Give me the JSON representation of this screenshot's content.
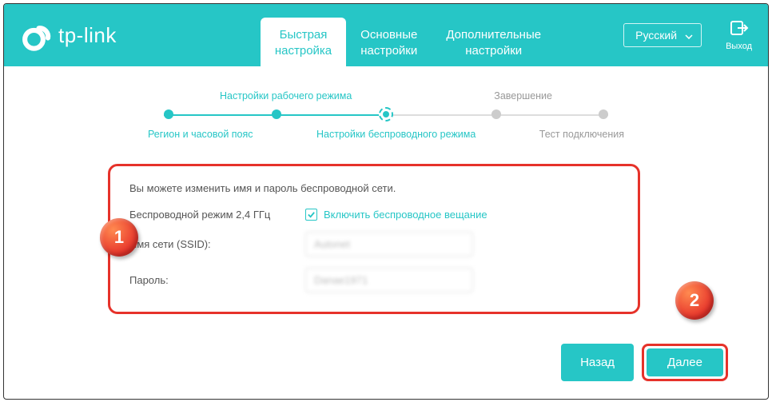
{
  "brand": "tp-link",
  "header": {
    "tabs": [
      {
        "line1": "Быстрая",
        "line2": "настройка"
      },
      {
        "line1": "Основные",
        "line2": "настройки"
      },
      {
        "line1": "Дополнительные",
        "line2": "настройки"
      }
    ],
    "language": "Русский",
    "exit": "Выход"
  },
  "stepper": {
    "top": {
      "mode": "Настройки рабочего режима",
      "finish": "Завершение"
    },
    "bottom": {
      "region": "Регион и часовой пояс",
      "wireless": "Настройки беспроводного режима",
      "test": "Тест подключения"
    }
  },
  "form": {
    "instruction": "Вы можете изменить имя и пароль беспроводной сети.",
    "band_label": "Беспроводной режим 2,4 ГГц",
    "enable_label": "Включить беспроводное вещание",
    "ssid_label": "Имя сети (SSID):",
    "ssid_value": "Autonet",
    "pass_label": "Пароль:",
    "pass_value": "Danae1971"
  },
  "buttons": {
    "back": "Назад",
    "next": "Далее"
  },
  "annotations": {
    "one": "1",
    "two": "2"
  },
  "colors": {
    "accent": "#26c6c6",
    "highlight": "#e6322a",
    "badge_grad_a": "#ff8a50",
    "badge_grad_b": "#e6322a"
  }
}
